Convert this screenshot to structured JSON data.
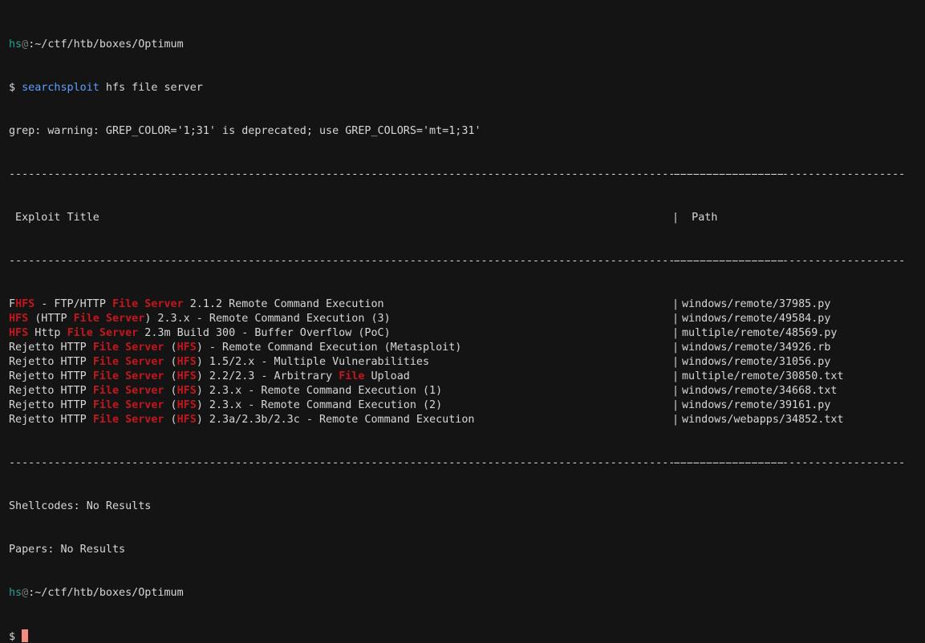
{
  "prompt1": {
    "user": "hs",
    "at": "@",
    "cwd": ":~/ctf/htb/boxes/Optimum"
  },
  "command": {
    "dollar": "$ ",
    "program": "searchsploit",
    "args": " hfs file server"
  },
  "warning": "grep: warning: GREP_COLOR='1;31' is deprecated; use GREP_COLORS='mt=1;31'",
  "separator_left": "------------------------------------------------------------------------------------------------------------------------",
  "separator_right": "------------------------------------",
  "header": {
    "title": " Exploit Title",
    "bar": "|",
    "path": "  Path"
  },
  "results": [
    {
      "parts": [
        {
          "t": "F",
          "h": false
        },
        {
          "t": "HFS",
          "h": true
        },
        {
          "t": " - FTP/HTTP ",
          "h": false
        },
        {
          "t": "File Server",
          "h": true
        },
        {
          "t": " 2.1.2 Remote Command Execution",
          "h": false
        }
      ],
      "path": "windows/remote/37985.py"
    },
    {
      "parts": [
        {
          "t": "HFS",
          "h": true
        },
        {
          "t": " (HTTP ",
          "h": false
        },
        {
          "t": "File Server",
          "h": true
        },
        {
          "t": ") 2.3.x - Remote Command Execution (3)",
          "h": false
        }
      ],
      "path": "windows/remote/49584.py"
    },
    {
      "parts": [
        {
          "t": "HFS",
          "h": true
        },
        {
          "t": " Http ",
          "h": false
        },
        {
          "t": "File Server",
          "h": true
        },
        {
          "t": " 2.3m Build 300 - Buffer Overflow (PoC)",
          "h": false
        }
      ],
      "path": "multiple/remote/48569.py"
    },
    {
      "parts": [
        {
          "t": "Rejetto HTTP ",
          "h": false
        },
        {
          "t": "File Server",
          "h": true
        },
        {
          "t": " (",
          "h": false
        },
        {
          "t": "HFS",
          "h": true
        },
        {
          "t": ") - Remote Command Execution (Metasploit)",
          "h": false
        }
      ],
      "path": "windows/remote/34926.rb"
    },
    {
      "parts": [
        {
          "t": "Rejetto HTTP ",
          "h": false
        },
        {
          "t": "File Server",
          "h": true
        },
        {
          "t": " (",
          "h": false
        },
        {
          "t": "HFS",
          "h": true
        },
        {
          "t": ") 1.5/2.x - Multiple Vulnerabilities",
          "h": false
        }
      ],
      "path": "windows/remote/31056.py"
    },
    {
      "parts": [
        {
          "t": "Rejetto HTTP ",
          "h": false
        },
        {
          "t": "File Server",
          "h": true
        },
        {
          "t": " (",
          "h": false
        },
        {
          "t": "HFS",
          "h": true
        },
        {
          "t": ") 2.2/2.3 - Arbitrary ",
          "h": false
        },
        {
          "t": "File",
          "h": true
        },
        {
          "t": " Upload",
          "h": false
        }
      ],
      "path": "multiple/remote/30850.txt"
    },
    {
      "parts": [
        {
          "t": "Rejetto HTTP ",
          "h": false
        },
        {
          "t": "File Server",
          "h": true
        },
        {
          "t": " (",
          "h": false
        },
        {
          "t": "HFS",
          "h": true
        },
        {
          "t": ") 2.3.x - Remote Command Execution (1)",
          "h": false
        }
      ],
      "path": "windows/remote/34668.txt"
    },
    {
      "parts": [
        {
          "t": "Rejetto HTTP ",
          "h": false
        },
        {
          "t": "File Server",
          "h": true
        },
        {
          "t": " (",
          "h": false
        },
        {
          "t": "HFS",
          "h": true
        },
        {
          "t": ") 2.3.x - Remote Command Execution (2)",
          "h": false
        }
      ],
      "path": "windows/remote/39161.py"
    },
    {
      "parts": [
        {
          "t": "Rejetto HTTP ",
          "h": false
        },
        {
          "t": "File Server",
          "h": true
        },
        {
          "t": " (",
          "h": false
        },
        {
          "t": "HFS",
          "h": true
        },
        {
          "t": ") 2.3a/2.3b/2.3c - Remote Command Execution",
          "h": false
        }
      ],
      "path": "windows/webapps/34852.txt"
    }
  ],
  "row_bar": "|",
  "shellcodes": "Shellcodes: No Results",
  "papers": "Papers: No Results",
  "prompt2": {
    "user": "hs",
    "at": "@",
    "cwd": ":~/ctf/htb/boxes/Optimum",
    "dollar": "$ "
  },
  "colors": {
    "background": "#141414",
    "highlight": "#c4161c",
    "command": "#5aa0ff",
    "user": "#2aa198",
    "cursor": "#f28b82"
  }
}
